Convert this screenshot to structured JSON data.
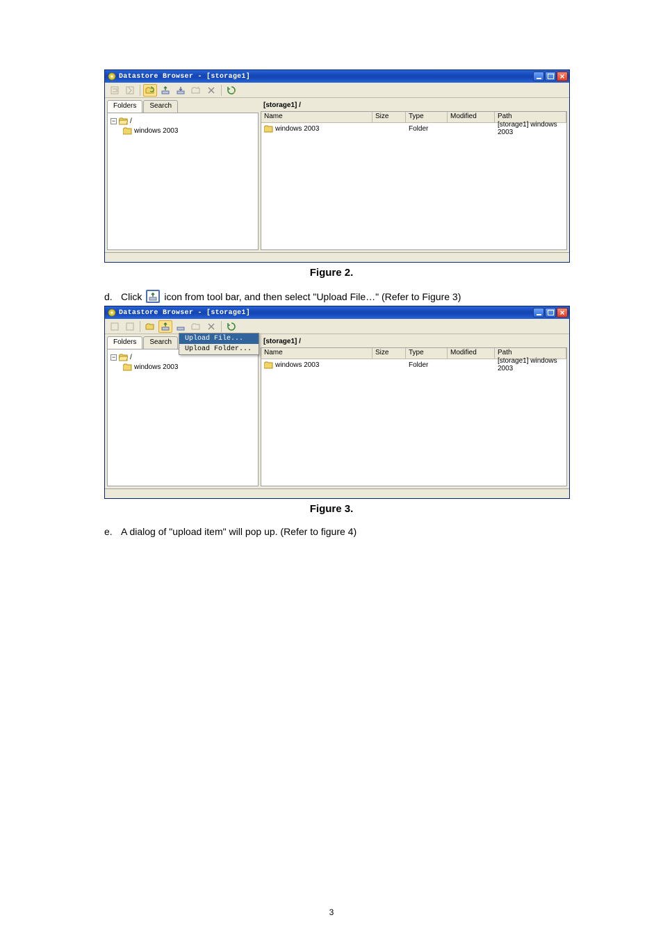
{
  "window_title": "Datastore Browser - [storage1]",
  "toolbar_icons": [
    "nav-back",
    "nav-open",
    "refresh-folder",
    "upload",
    "download",
    "new-folder",
    "delete"
  ],
  "refresh_icon": "refresh",
  "tabs": {
    "folders": "Folders",
    "search": "Search"
  },
  "tree_root_label": "/",
  "tree_child_label": "windows 2003",
  "crumb_label": "[storage1] /",
  "grid_headers": {
    "name": "Name",
    "size": "Size",
    "type": "Type",
    "modified": "Modified",
    "path": "Path"
  },
  "grid_row": {
    "name": "windows 2003",
    "size": "",
    "type": "Folder",
    "modified": "",
    "path": "[storage1] windows 2003"
  },
  "fig2_caption": "Figure 2.",
  "instr_d_letter": "d.",
  "instr_d_pre": "Click",
  "instr_d_post": "icon from tool bar, and then select \"Upload File…\" (Refer to Figure 3)",
  "ctx_upload_file": "Upload File...",
  "ctx_upload_folder": "Upload Folder...",
  "fig3_caption": "Figure 3.",
  "instr_e_letter": "e.",
  "instr_e_text": "A dialog of \"upload item\" will pop up. (Refer to figure 4)",
  "page_number": "3"
}
